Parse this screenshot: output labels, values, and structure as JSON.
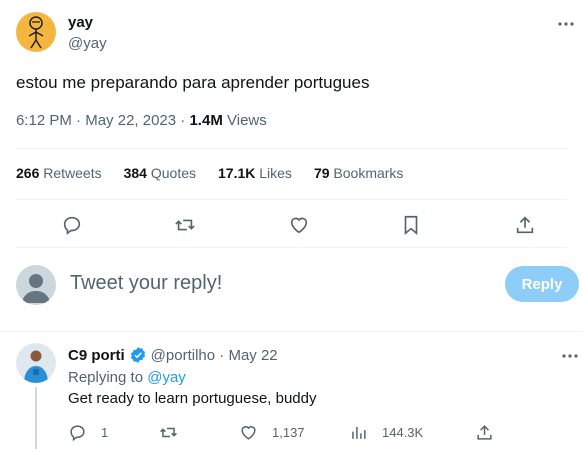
{
  "tweet": {
    "author_name": "yay",
    "author_handle": "@yay",
    "text": "estou me preparando para aprender portugues",
    "time": "6:12 PM",
    "date": "May 22, 2023",
    "views_count": "1.4M",
    "views_label": "Views",
    "stats": {
      "retweets_count": "266",
      "retweets_label": "Retweets",
      "quotes_count": "384",
      "quotes_label": "Quotes",
      "likes_count": "17.1K",
      "likes_label": "Likes",
      "bookmarks_count": "79",
      "bookmarks_label": "Bookmarks"
    },
    "actions": [
      "reply-icon",
      "retweet-icon",
      "like-icon",
      "bookmark-icon",
      "share-icon"
    ]
  },
  "composer": {
    "placeholder": "Tweet your reply!",
    "button_label": "Reply"
  },
  "reply": {
    "author_name": "C9 porti",
    "author_handle": "@portilho",
    "date": "May 22",
    "replying_prefix": "Replying to",
    "replying_to": "@yay",
    "text": "Get ready to learn portuguese, buddy",
    "reply_count": "1",
    "retweet_count": "",
    "like_count": "1,137",
    "views_count": "144.3K"
  },
  "colors": {
    "accent": "#1d9bf0",
    "reply_button": "#8ecdf8",
    "muted_text": "#536471",
    "divider": "#eff3f4",
    "avatar_main": "#f4b63f"
  }
}
